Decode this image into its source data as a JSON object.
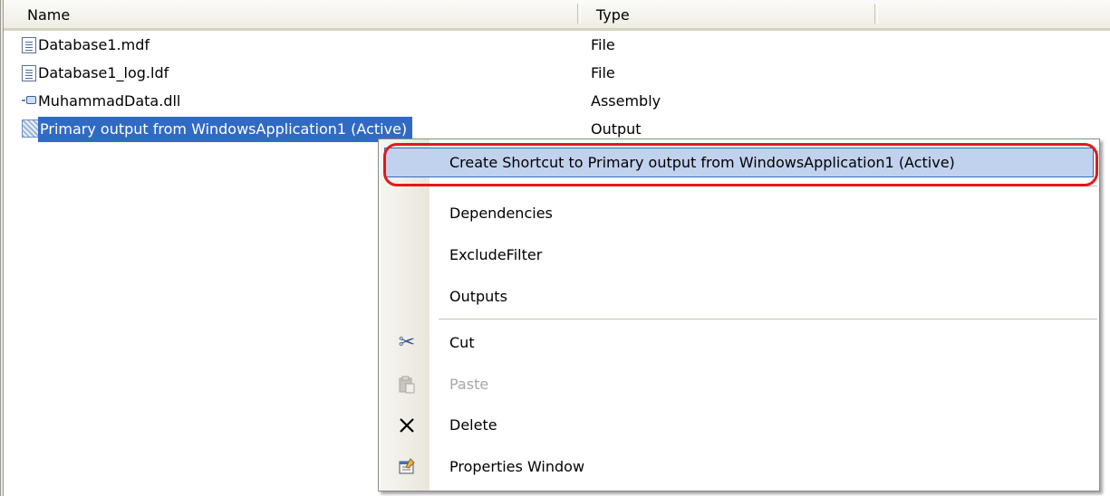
{
  "list": {
    "columns": {
      "name": "Name",
      "type": "Type"
    },
    "rows": [
      {
        "name": "Database1.mdf",
        "type": "File",
        "icon": "document-icon"
      },
      {
        "name": "Database1_log.ldf",
        "type": "File",
        "icon": "document-icon"
      },
      {
        "name": "MuhammadData.dll",
        "type": "Assembly",
        "icon": "assembly-icon"
      },
      {
        "name": "Primary output from WindowsApplication1 (Active)",
        "type": "Output",
        "icon": "primary-output-icon",
        "selected": true
      }
    ]
  },
  "context_menu": {
    "items": [
      {
        "label": "Create Shortcut to Primary output from WindowsApplication1 (Active)",
        "highlighted": true
      },
      {
        "label": "Dependencies"
      },
      {
        "label": "ExcludeFilter"
      },
      {
        "label": "Outputs"
      },
      {
        "label": "Cut",
        "icon": "scissors-icon"
      },
      {
        "label": "Paste",
        "icon": "paste-icon",
        "disabled": true
      },
      {
        "label": "Delete",
        "icon": "delete-icon"
      },
      {
        "label": "Properties Window",
        "icon": "properties-icon"
      }
    ]
  },
  "colors": {
    "selection": "#316ac5",
    "menu_highlight": "#c1d2ee",
    "annotation_ring": "#e01a1a"
  }
}
